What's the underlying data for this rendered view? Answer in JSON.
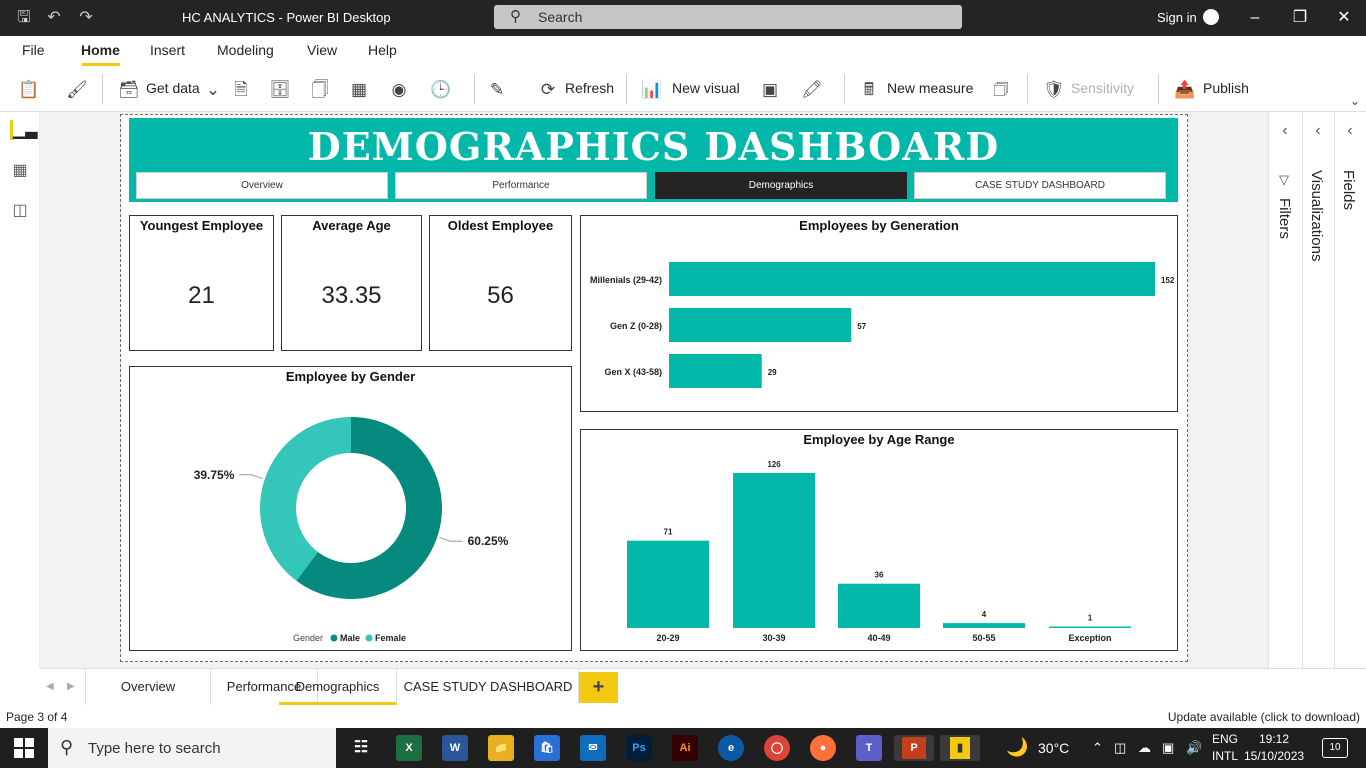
{
  "titlebar": {
    "title": "HC ANALYTICS - Power BI Desktop",
    "search": "Search",
    "signin": "Sign in"
  },
  "menu": [
    "File",
    "Home",
    "Insert",
    "Modeling",
    "View",
    "Help"
  ],
  "ribbon": {
    "get_data": "Get data",
    "refresh": "Refresh",
    "new_visual": "New visual",
    "new_measure": "New measure",
    "sensitivity": "Sensitivity",
    "publish": "Publish"
  },
  "dashboard": {
    "title": "DEMOGRAPHICS DASHBOARD",
    "nav": [
      "Overview",
      "Performance",
      "Demographics",
      "CASE STUDY DASHBOARD"
    ],
    "cards": [
      {
        "title": "Youngest Employee",
        "value": "21"
      },
      {
        "title": "Average Age",
        "value": "33.35"
      },
      {
        "title": "Oldest Employee",
        "value": "56"
      }
    ],
    "gender_title": "Employee by Gender",
    "generation_title": "Employees by Generation",
    "age_title": "Employee by Age Range"
  },
  "chart_data": [
    {
      "type": "bar",
      "orientation": "horizontal",
      "title": "Employees by Generation",
      "categories": [
        "Millenials (29-42)",
        "Gen Z (0-28)",
        "Gen X (43-58)"
      ],
      "values": [
        152,
        57,
        29
      ],
      "color": "#04b8a9"
    },
    {
      "type": "pie",
      "subtype": "donut",
      "title": "Employee by Gender",
      "legend_title": "Gender",
      "labels": [
        "Male",
        "Female"
      ],
      "values": [
        60.25,
        39.75
      ],
      "value_labels": [
        "60.25%",
        "39.75%"
      ],
      "colors": [
        "#078a7e",
        "#34c6b8"
      ],
      "legend_position": "bottom-center"
    },
    {
      "type": "bar",
      "title": "Employee by Age Range",
      "categories": [
        "20-29",
        "30-39",
        "40-49",
        "50-55",
        "Exception"
      ],
      "values": [
        71,
        126,
        36,
        4,
        1
      ],
      "color": "#04b8a9"
    }
  ],
  "right_panes": {
    "filters": "Filters",
    "visualizations": "Visualizations",
    "fields": "Fields"
  },
  "page_tabs": [
    "Overview",
    "Performance",
    "Demographics",
    "CASE STUDY DASHBOARD"
  ],
  "add_tab": "+",
  "status": {
    "page": "Page 3 of 4",
    "update": "Update available (click to download)"
  },
  "taskbar": {
    "search": "Type here to search",
    "temp": "30°C",
    "lang1": "ENG",
    "lang2": "INTL",
    "time": "19:12",
    "date": "15/10/2023",
    "notif": "10"
  }
}
